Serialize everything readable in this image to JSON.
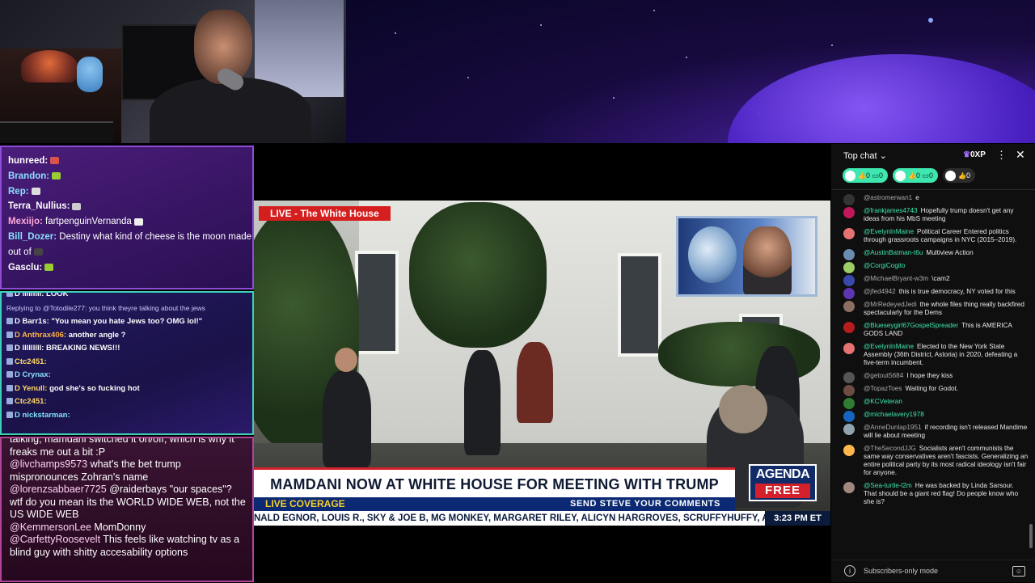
{
  "panel1": {
    "lines": [
      {
        "user": "hunreed:",
        "user_color": "#ffffff",
        "text": ""
      },
      {
        "user": "Brandon:",
        "user_color": "#8be0ff",
        "text": ""
      },
      {
        "user": "Rep:",
        "user_color": "#8be0ff",
        "text": ""
      },
      {
        "user": "Terra_Nullius:",
        "user_color": "#ffffff",
        "text": ""
      },
      {
        "user": "Mexiijo:",
        "user_color": "#ffa8d8",
        "text": "fartpenguinVernanda"
      },
      {
        "user": "Bill_Dozer:",
        "user_color": "#8be0ff",
        "text": "Destiny what kind of cheese is the moon made"
      },
      {
        "user": "",
        "user_color": "#ffffff",
        "text": "out of"
      },
      {
        "user": "Gasclu:",
        "user_color": "#ffffff",
        "text": ""
      }
    ]
  },
  "panel2": {
    "lines": [
      {
        "user": "D lllllllll:",
        "user_color": "#ffffff",
        "text": "LOOK"
      },
      {
        "user": "",
        "user_color": "#cfc7ff",
        "text": "Replying to @Totodile277: you think theyre talking about the jews",
        "reply": true
      },
      {
        "user": "D Barr1s:",
        "user_color": "#ffffff",
        "text": "\"You mean you hate Jews too? OMG lol!\""
      },
      {
        "user": "D Anthrax406:",
        "user_color": "#ffb347",
        "text": "another angle ?"
      },
      {
        "user": "D lllllllll:",
        "user_color": "#ffffff",
        "text": "BREAKING NEWS!!!"
      },
      {
        "user": "Ctc2451:",
        "user_color": "#ffd966",
        "text": ""
      },
      {
        "user": "D Crynax:",
        "user_color": "#8be0ff",
        "text": ""
      },
      {
        "user": "D Yenull:",
        "user_color": "#ffd966",
        "text": "god she's so fucking hot"
      },
      {
        "user": "Ctc2451:",
        "user_color": "#ffd966",
        "text": ""
      },
      {
        "user": "D nickstarman:",
        "user_color": "#7fe3ff",
        "text": ""
      }
    ]
  },
  "panel3": {
    "lines": [
      {
        "user": "",
        "text": "talking, mamdani switched it on/off, which is why it freaks me out a bit :P"
      },
      {
        "user": "@livchamps9573",
        "text": "what's the bet trump mispronounces Zohran's name"
      },
      {
        "user": "@lorenzsabbaer7725",
        "text": "@raiderbays \"our spaces\"? wtf do you mean its the WORLD WIDE WEB, not the US WIDE WEB"
      },
      {
        "user": "@KemmersonLee",
        "text": "MomDonny"
      },
      {
        "user": "@CarfettyRoosevelt",
        "text": "This feels like watching tv as a blind guy with shitty accesability options"
      }
    ]
  },
  "video": {
    "live_tag": "LIVE - The White House",
    "headline": "MAMDANI NOW AT WHITE HOUSE FOR MEETING WITH TRUMP",
    "live_coverage": "LIVE COVERAGE",
    "send_steve": "SEND STEVE YOUR COMMENTS",
    "logo_top": "AGENDA",
    "logo_bottom": "FREE",
    "ticker": "NALD EGNOR, LOUIS R., SKY & JOE B, MG MONKEY, MARGARET RILEY, ALICYN HARGROVES, SCRUFFYHUFFY, AND THORN RAVENS",
    "time": "3:23 PM ET"
  },
  "ytchat": {
    "mode": "Top chat",
    "xp": "0XP",
    "pills": [
      {
        "likes": "0",
        "comments": "0",
        "style": "green"
      },
      {
        "likes": "0",
        "comments": "0",
        "style": "green"
      },
      {
        "likes": "0",
        "comments": "",
        "style": "dark"
      }
    ],
    "messages": [
      {
        "user": "@astromerwan1",
        "text": "e",
        "av": "#333",
        "member": false
      },
      {
        "user": "@frankjames4743",
        "text": "Hopefully trump doesn't get any ideas from his MbS meeting",
        "av": "#c2185b",
        "member": true
      },
      {
        "user": "@EvelynInMaine",
        "text": "Political Career Entered politics through grassroots campaigns in NYC (2015–2019).",
        "av": "#e57373",
        "member": true
      },
      {
        "user": "@AustinBatman-t6u",
        "text": "Multiview Action",
        "av": "#6a8caf",
        "member": true
      },
      {
        "user": "@CorgiCogito",
        "text": "",
        "av": "#9ccc65",
        "member": true
      },
      {
        "user": "@MichaelBryant-w3m",
        "text": "\\cam2",
        "av": "#3949ab",
        "member": false
      },
      {
        "user": "@jfed4942",
        "text": "this is true democracy, NY voted for this",
        "av": "#5e35b1",
        "member": false
      },
      {
        "user": "@MrRedeyedJedi",
        "text": "the whole files thing really backfired spectacularly for the Dems",
        "av": "#8d6e63",
        "member": false
      },
      {
        "user": "@Blueseygirl67GospelSpreader",
        "text": "This is AMERICA GODS LAND",
        "av": "#b71c1c",
        "member": true
      },
      {
        "user": "@EvelynInMaine",
        "text": "Elected to the New York State Assembly (36th District, Astoria) in 2020, defeating a five-term incumbent.",
        "av": "#e57373",
        "member": true
      },
      {
        "user": "@getout5684",
        "text": "I hope they kiss",
        "av": "#555",
        "member": false
      },
      {
        "user": "@TopazToes",
        "text": "Waiting for Godot.",
        "av": "#6d4c41",
        "member": false
      },
      {
        "user": "@KCVeteran",
        "text": "",
        "av": "#2e7d32",
        "member": true
      },
      {
        "user": "@michaelavery1978",
        "text": "",
        "av": "#1565c0",
        "member": true
      },
      {
        "user": "@AnneDunlap1951",
        "text": "if recording isn't released Mandime will lie about meeting",
        "av": "#90a4ae",
        "member": false
      },
      {
        "user": "@TheSecondJJG",
        "text": "Socialists aren't communists the same way conservatives aren't fascists. Generalizing an entire political party by its most radical ideology isn't fair for anyone.",
        "av": "#ffb74d",
        "member": false
      },
      {
        "user": "@Sea-turtle-l2m",
        "text": "He was backed by Linda Sarsour. That should be a giant red flag! Do people know who she is?",
        "av": "#a1887f",
        "member": true
      }
    ],
    "footer": "Subscribers-only mode"
  },
  "colors": {
    "accent_green": "#3fe7b0",
    "news_red": "#d3202a",
    "news_navy": "#0b2a73"
  }
}
